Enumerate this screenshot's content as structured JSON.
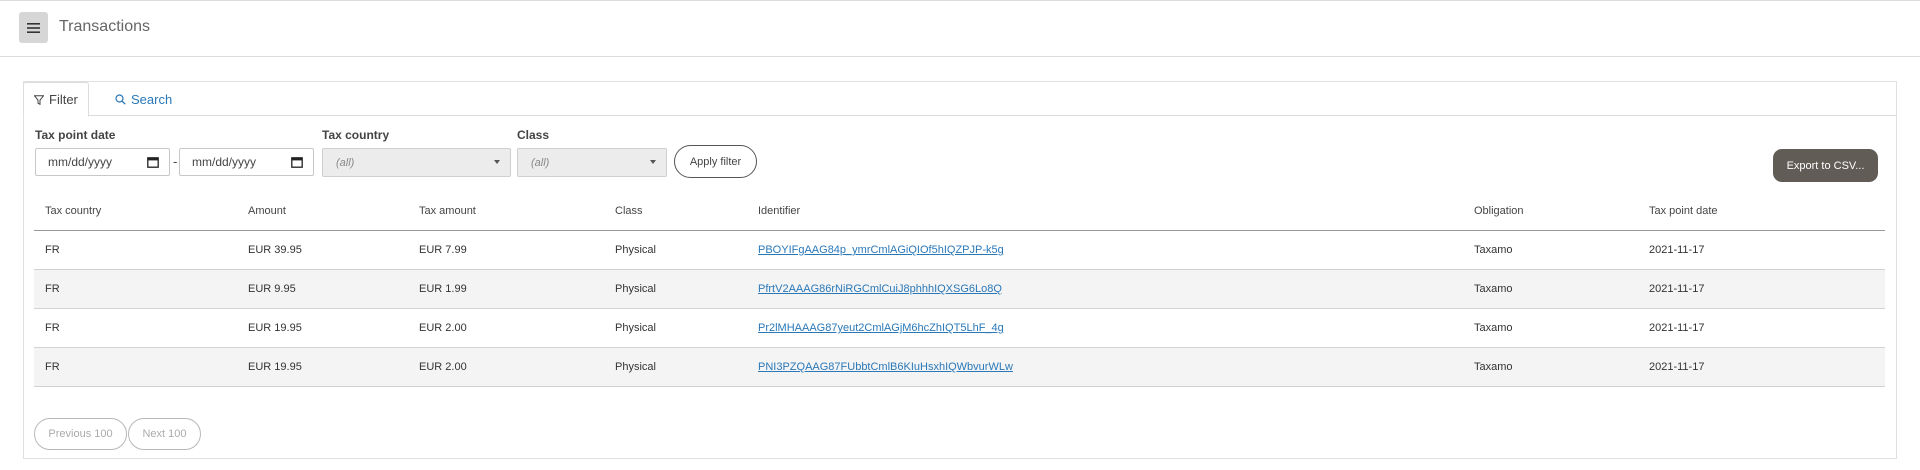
{
  "header": {
    "title": "Transactions",
    "menu_icon": "hamburger-menu-icon"
  },
  "tabs": [
    {
      "label": "Filter",
      "icon": "filter-icon",
      "active": true
    },
    {
      "label": "Search",
      "icon": "search-icon",
      "active": false
    }
  ],
  "filters": {
    "tax_point_date": {
      "label": "Tax point date",
      "from_placeholder": "mm/dd/yyyy",
      "to_placeholder": "mm/dd/yyyy",
      "separator": "-"
    },
    "tax_country": {
      "label": "Tax country",
      "value": "(all)"
    },
    "class": {
      "label": "Class",
      "value": "(all)"
    },
    "apply_label": "Apply filter"
  },
  "export_label": "Export to CSV...",
  "table": {
    "columns": [
      "Tax country",
      "Amount",
      "Tax amount",
      "Class",
      "Identifier",
      "Obligation",
      "Tax point date"
    ],
    "rows": [
      [
        "FR",
        "EUR 39.95",
        "EUR 7.99",
        "Physical",
        "PBOYIFgAAG84p_ymrCmlAGiQIOf5hIQZPJP-k5g",
        "Taxamo",
        "2021-11-17"
      ],
      [
        "FR",
        "EUR 9.95",
        "EUR 1.99",
        "Physical",
        "PfrtV2AAAG86rNiRGCmlCuiJ8phhhIQXSG6Lo8Q",
        "Taxamo",
        "2021-11-17"
      ],
      [
        "FR",
        "EUR 19.95",
        "EUR 2.00",
        "Physical",
        "Pr2lMHAAAG87yeut2CmlAGjM6hcZhIQT5LhF_4g",
        "Taxamo",
        "2021-11-17"
      ],
      [
        "FR",
        "EUR 19.95",
        "EUR 2.00",
        "Physical",
        "PNI3PZQAAG87FUbbtCmlB6KIuHsxhIQWbvurWLw",
        "Taxamo",
        "2021-11-17"
      ]
    ]
  },
  "pagination": {
    "previous_label": "Previous 100",
    "next_label": "Next 100"
  },
  "colors": {
    "link": "#2a78b8",
    "export_button": "#615c56"
  }
}
